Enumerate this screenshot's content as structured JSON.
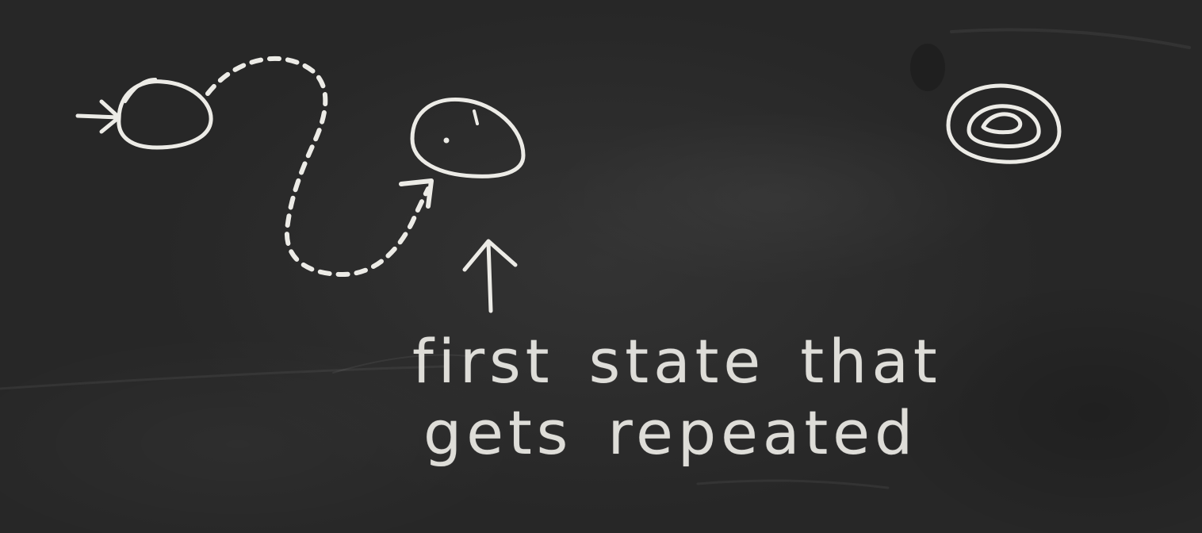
{
  "board": {
    "background": "#2b2b2b",
    "chalk_color": "#ecebe6"
  },
  "diagram": {
    "nodes": [
      {
        "name": "start-state",
        "has_entry_arrow": true
      },
      {
        "name": "repeated-state",
        "has_dot": true
      },
      {
        "name": "nested-state",
        "shape": "nested-loops"
      }
    ],
    "edges": [
      {
        "from": "start-state",
        "to": "repeated-state",
        "style": "dashed"
      }
    ]
  },
  "annotation": {
    "line_1": "first state that",
    "line_2": "gets repeated"
  }
}
